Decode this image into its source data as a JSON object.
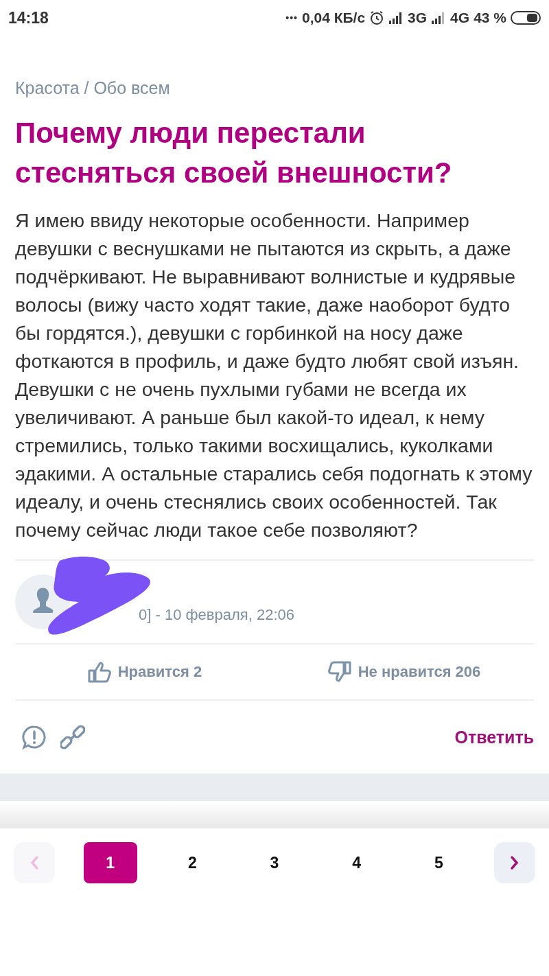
{
  "status_bar": {
    "time": "14:18",
    "dots": "•••",
    "speed": "0,04 КБ/с",
    "network_1": "3G",
    "network_2": "4G",
    "battery": "43 %"
  },
  "breadcrumb": "Красота / Обо всем",
  "title": "Почему люди перестали стесняться своей внешности?",
  "body": "Я имею ввиду некоторые особенности. Например девушки с веснушками не пытаются из скрыть, а даже подчёркивают. Не выравнивают волнистые и кудрявые волосы (вижу часто ходят такие, даже наоборот будто бы гордятся.), девушки с горбинкой на носу даже фоткаются в профиль, и даже будто любят свой изъян. Девушки с не очень пухлыми губами не всегда их увеличивают. А раньше был какой-то идеал, к нему стремились, только такими восхищались, куколками эдакими. А остальные старались себя подогнать к этому идеалу, и очень стеснялись своих особенностей. Так почему сейчас люди такое себе позволяют?",
  "author_meta": "0] - 10 февраля, 22:06",
  "votes": [
    {
      "kind": "like",
      "label": "Нравится 2"
    },
    {
      "kind": "dislike",
      "label": "Не нравится 206"
    }
  ],
  "reply": "Ответить",
  "pagination": {
    "prev_disabled": true,
    "next_disabled": false,
    "pages": [
      {
        "label": "1",
        "selected": true
      },
      {
        "label": "2",
        "selected": false
      },
      {
        "label": "3",
        "selected": false
      },
      {
        "label": "4",
        "selected": false
      },
      {
        "label": "5",
        "selected": false
      }
    ]
  }
}
